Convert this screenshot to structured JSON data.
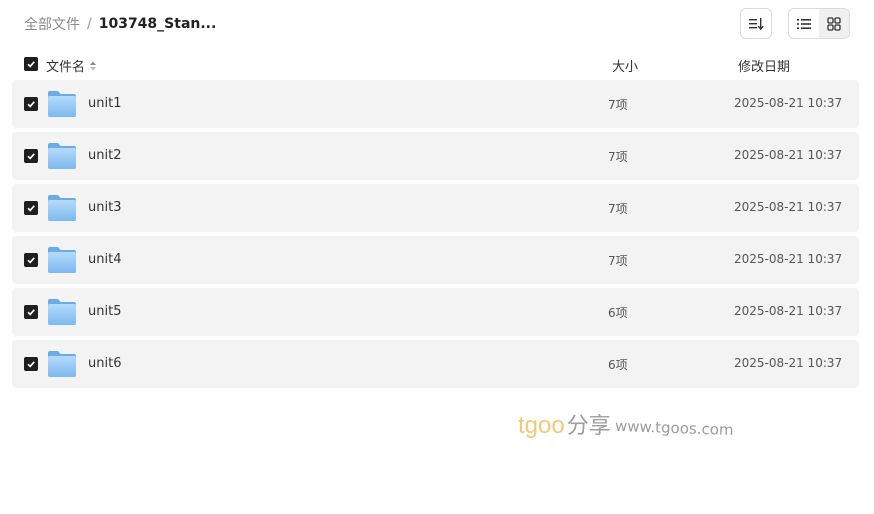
{
  "breadcrumb": {
    "root": "全部文件",
    "separator": "/",
    "current": "103748_Stan..."
  },
  "toolbar": {
    "sort_icon": "sort-icon",
    "list_view_icon": "list-view-icon",
    "grid_view_icon": "grid-view-icon",
    "active_view": "list"
  },
  "table": {
    "header": {
      "name": "文件名",
      "size": "大小",
      "date": "修改日期"
    },
    "rows": [
      {
        "name": "unit1",
        "size": "7项",
        "date": "2025-08-21 10:37",
        "checked": true
      },
      {
        "name": "unit2",
        "size": "7项",
        "date": "2025-08-21 10:37",
        "checked": true
      },
      {
        "name": "unit3",
        "size": "7项",
        "date": "2025-08-21 10:37",
        "checked": true
      },
      {
        "name": "unit4",
        "size": "7项",
        "date": "2025-08-21 10:37",
        "checked": true
      },
      {
        "name": "unit5",
        "size": "6项",
        "date": "2025-08-21 10:37",
        "checked": true
      },
      {
        "name": "unit6",
        "size": "6项",
        "date": "2025-08-21 10:37",
        "checked": true
      }
    ]
  },
  "watermark": {
    "brand": "tgoo",
    "cn": "分享",
    "url": "www.tgoos.com"
  },
  "colors": {
    "row_bg": "#f3f3f3",
    "checkbox": "#1f1f1f",
    "folder": "#8cc3f5"
  }
}
